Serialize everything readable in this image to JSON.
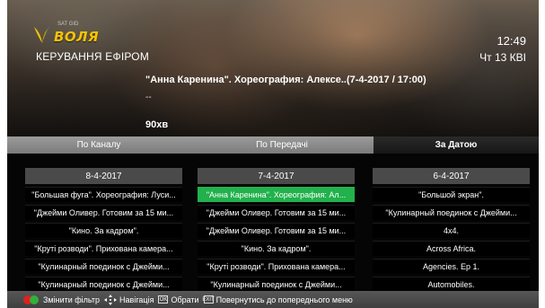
{
  "brand": {
    "logo_text": "ВОЛЯ",
    "logo_sub": "SAT GID"
  },
  "header": {
    "section_title": "КЕРУВАННЯ ЕФІРОМ",
    "time": "12:49",
    "date": "Чт 13 КВІ"
  },
  "program": {
    "title": "\"Анна Каренина\". Хореография: Алексе..(7-4-2017 / 17:00)",
    "description": "--",
    "duration": "90хв"
  },
  "tabs": [
    {
      "label": "По Каналу",
      "active": false
    },
    {
      "label": "По Передачі",
      "active": false
    },
    {
      "label": "За Датою",
      "active": true
    }
  ],
  "columns": [
    {
      "date": "8-4-2017",
      "items": [
        "\"Большая фуга\". Хореография: Луси...",
        "\"Джейми Оливер. Готовим за 15 ми...",
        "\"Кино. За кадром\".",
        "\"Круті розводи\". Прихована камера...",
        "\"Кулинарный поединок с Джейми...",
        "\"Кулинарный поединок с Джейми..."
      ]
    },
    {
      "date": "7-4-2017",
      "items": [
        "\"Анна Каренина\". Хореография: Ал...",
        "\"Джейми Оливер. Готовим за 15 ми...",
        "\"Джейми Оливер. Готовим за 15 ми...",
        "\"Кино. За кадром\".",
        "\"Круті розводи\". Прихована камера...",
        "\"Кулинарный поединок с Джейми..."
      ],
      "selected_index": 0
    },
    {
      "date": "6-4-2017",
      "items": [
        "\"Большой экран\".",
        "\"Кулинарный поединок с Джейми...",
        "4х4.",
        "Across Africa.",
        "Agencies. Ep 1.",
        "Automobiles."
      ]
    }
  ],
  "footer": {
    "filter_label": "Змінити фільтр",
    "nav_label": "Навігація",
    "ok_icon_label": "OK",
    "select_label": "Обрати",
    "back_icon_label": "EXIT",
    "back_label": "Повернутись до попереднього меню"
  },
  "colors": {
    "accent_green": "#22b14c",
    "logo_yellow": "#f7c300",
    "footer_red": "#e02020",
    "footer_green": "#2fb13a"
  }
}
